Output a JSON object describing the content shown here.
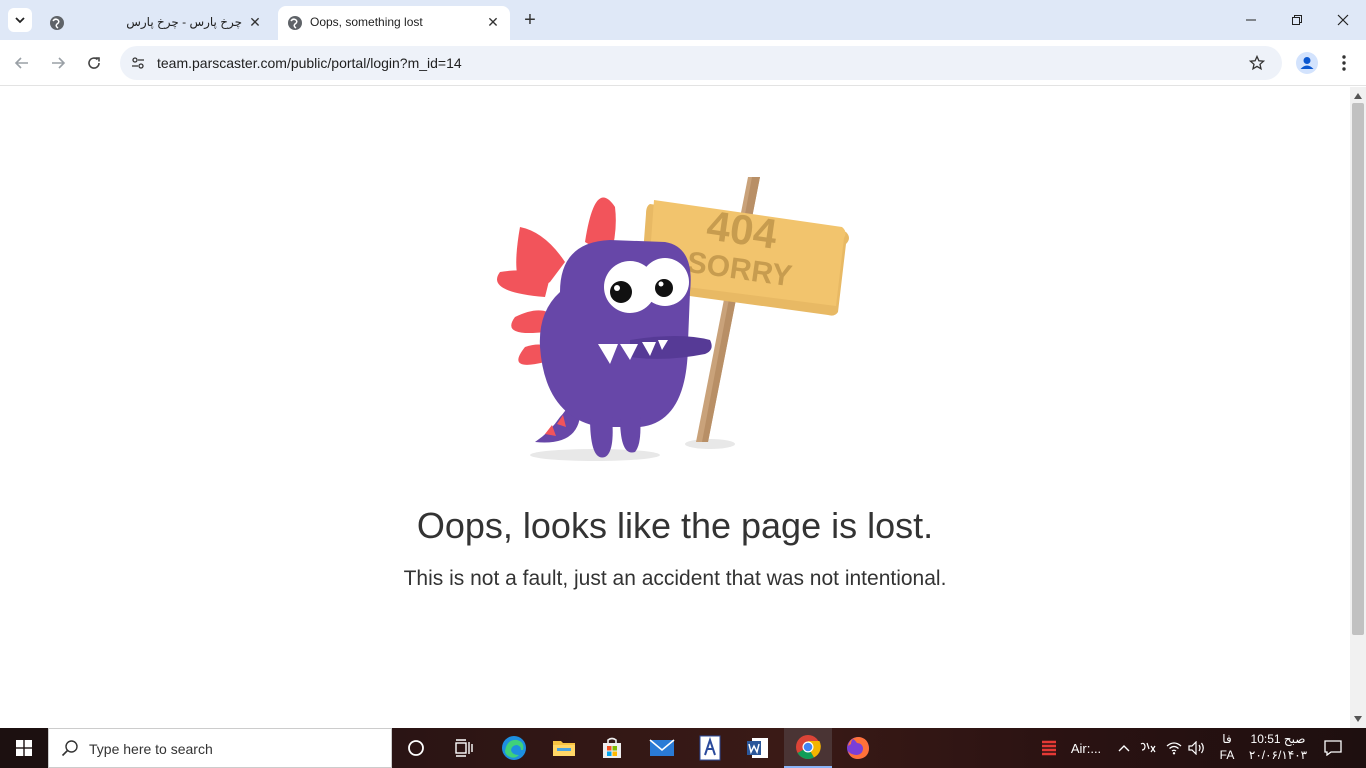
{
  "browser": {
    "tabs": [
      {
        "title": "چرخ پارس - چرخ پارس",
        "active": false
      },
      {
        "title": "Oops, something lost",
        "active": true
      }
    ],
    "url": "team.parscaster.com/public/portal/login?m_id=14"
  },
  "page": {
    "sign_top": "404",
    "sign_bottom": "SORRY",
    "heading": "Oops, looks like the page is lost.",
    "subheading": "This is not a fault, just an accident that was not intentional."
  },
  "taskbar": {
    "search_placeholder": "Type here to search",
    "tray_app_label": "Air:...",
    "lang_top": "فا",
    "lang_bottom": "FA",
    "time": "10:51 صبح",
    "date": "۲۰/۰۶/۱۴۰۳"
  },
  "colors": {
    "monster": "#6747a8",
    "spikes": "#f2545b",
    "sign": "#f2c46d",
    "stick": "#c9a27a"
  }
}
